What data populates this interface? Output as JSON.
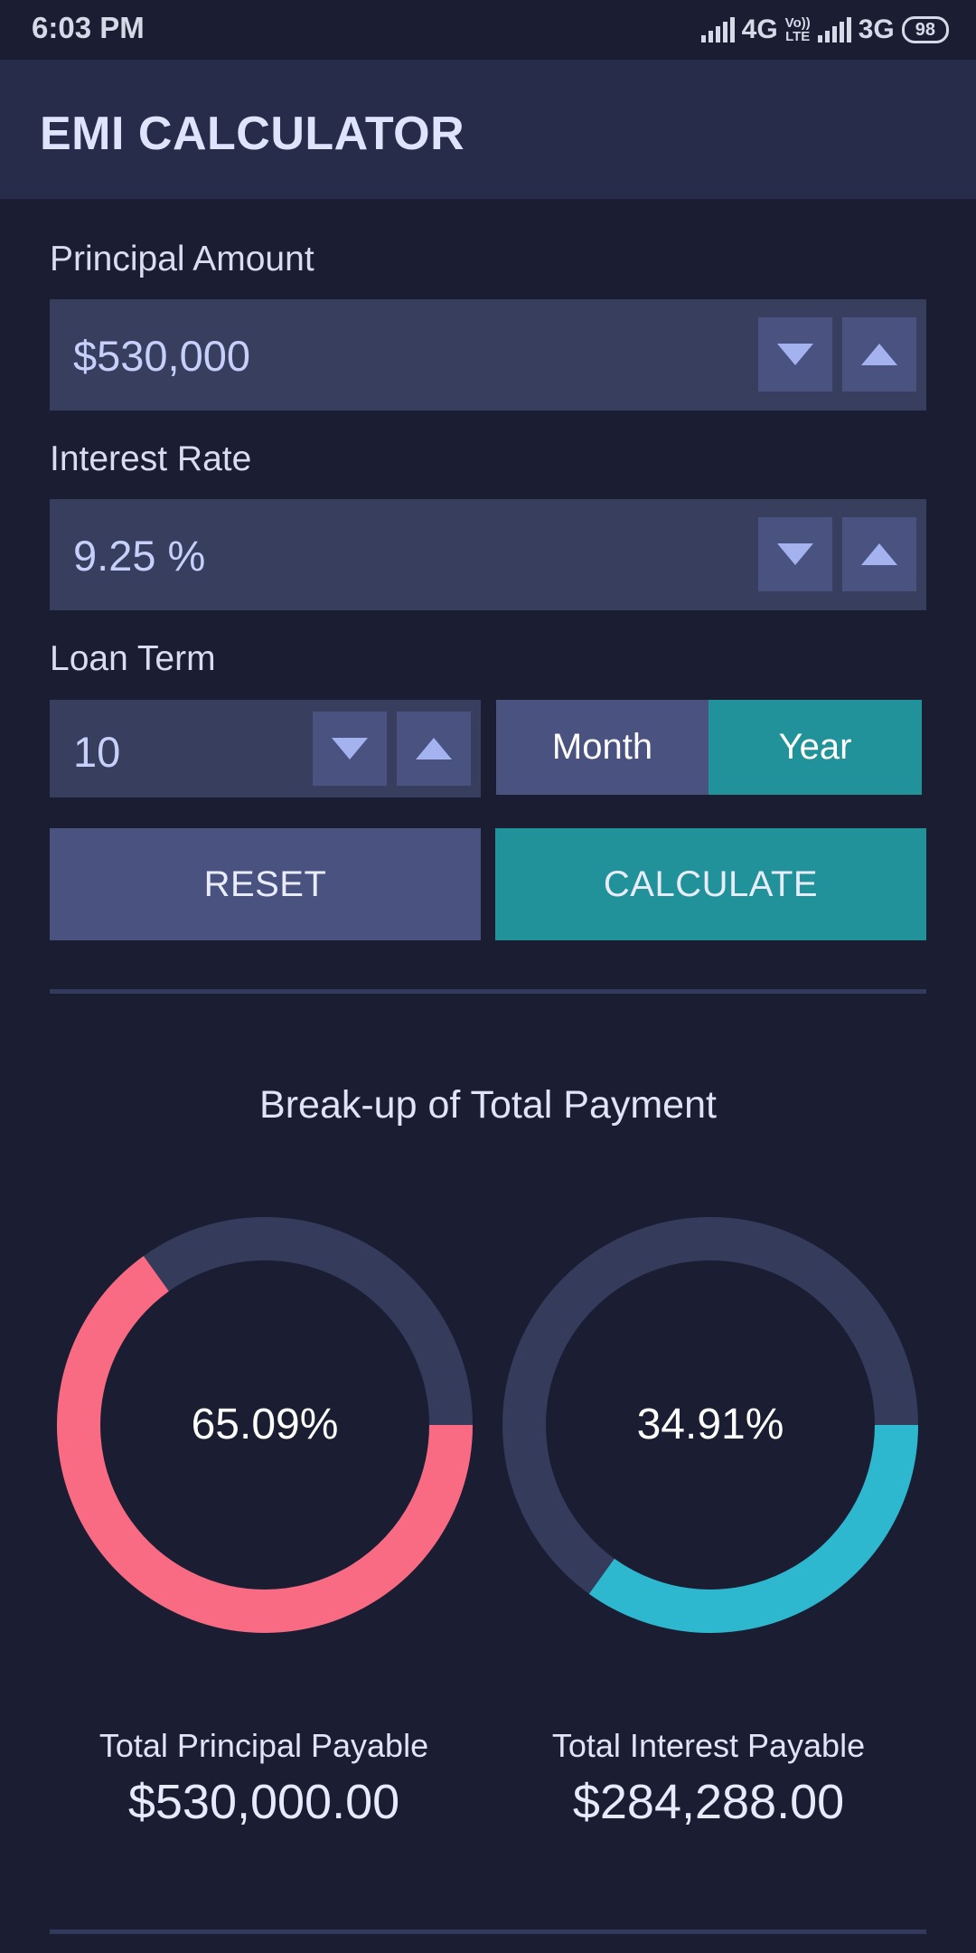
{
  "status_bar": {
    "time": "6:03 PM",
    "network1": "4G",
    "volte_top": "Vo))",
    "volte_bottom": "LTE",
    "network2": "3G",
    "battery": "98"
  },
  "app_bar": {
    "title": "EMI CALCULATOR"
  },
  "form": {
    "principal": {
      "label": "Principal Amount",
      "value": "$530,000"
    },
    "interest": {
      "label": "Interest Rate",
      "value": "9.25 %"
    },
    "term": {
      "label": "Loan Term",
      "value": "10",
      "unit_month": "Month",
      "unit_year": "Year",
      "selected_unit": "Year"
    },
    "reset_label": "RESET",
    "calculate_label": "CALCULATE"
  },
  "colors": {
    "accent_teal": "#219299",
    "principal_color": "#f96b82",
    "interest_color": "#2db8d0",
    "track_color": "#353b5b"
  },
  "chart_data": {
    "type": "pie",
    "title": "Break-up of Total Payment",
    "charts": [
      {
        "label_text": "65.09%",
        "percent": 65.09,
        "color": "#f96b82"
      },
      {
        "label_text": "34.91%",
        "percent": 34.91,
        "color": "#2db8d0"
      }
    ]
  },
  "summary": {
    "principal": {
      "label": "Total Principal Payable",
      "value": "$530,000.00"
    },
    "interest": {
      "label": "Total Interest Payable",
      "value": "$284,288.00"
    }
  }
}
